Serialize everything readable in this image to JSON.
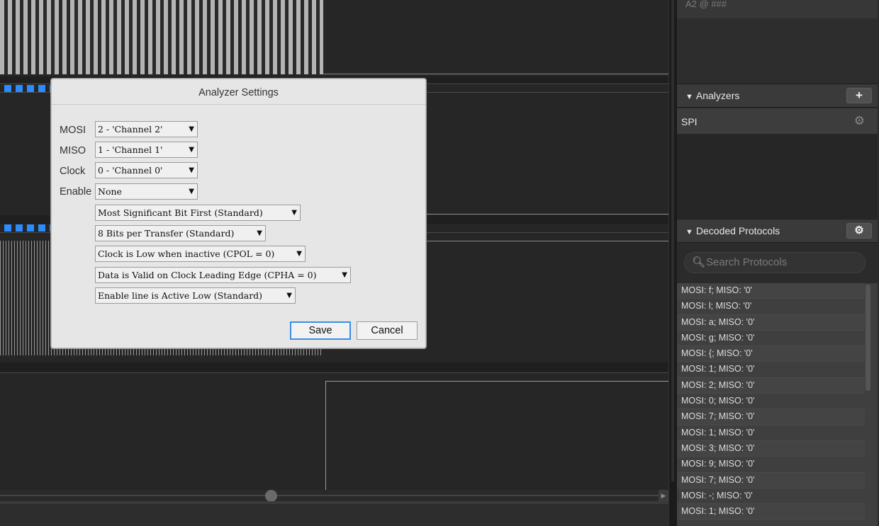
{
  "measurement": {
    "header_text": "A2 @ ###"
  },
  "dialog": {
    "title": "Analyzer Settings",
    "fields": [
      {
        "label": "MOSI",
        "value": "2 - 'Channel 2'"
      },
      {
        "label": "MISO",
        "value": "1 - 'Channel 1'"
      },
      {
        "label": "Clock",
        "value": "0 - 'Channel 0'"
      },
      {
        "label": "Enable",
        "value": "None"
      }
    ],
    "options": [
      "Most Significant Bit First (Standard)",
      "8 Bits per Transfer (Standard)",
      "Clock is Low when inactive (CPOL = 0)",
      "Data is Valid on Clock Leading Edge (CPHA = 0)",
      "Enable line is Active Low (Standard)"
    ],
    "save_label": "Save",
    "cancel_label": "Cancel"
  },
  "analyzers": {
    "title": "Analyzers",
    "add_label": "+",
    "items": [
      {
        "name": "SPI"
      }
    ]
  },
  "decoded": {
    "title": "Decoded Protocols",
    "search_placeholder": "Search Protocols",
    "rows": [
      "MOSI: f;  MISO: '0'",
      "MOSI: l;  MISO: '0'",
      "MOSI: a;  MISO: '0'",
      "MOSI: g;  MISO: '0'",
      "MOSI: {;  MISO: '0'",
      "MOSI: 1;  MISO: '0'",
      "MOSI: 2;  MISO: '0'",
      "MOSI: 0;  MISO: '0'",
      "MOSI: 7;  MISO: '0'",
      "MOSI: 1;  MISO: '0'",
      "MOSI: 3;  MISO: '0'",
      "MOSI: 9;  MISO: '0'",
      "MOSI: 7;  MISO: '0'",
      "MOSI: -;  MISO: '0'",
      "MOSI: 1;  MISO: '0'"
    ]
  }
}
